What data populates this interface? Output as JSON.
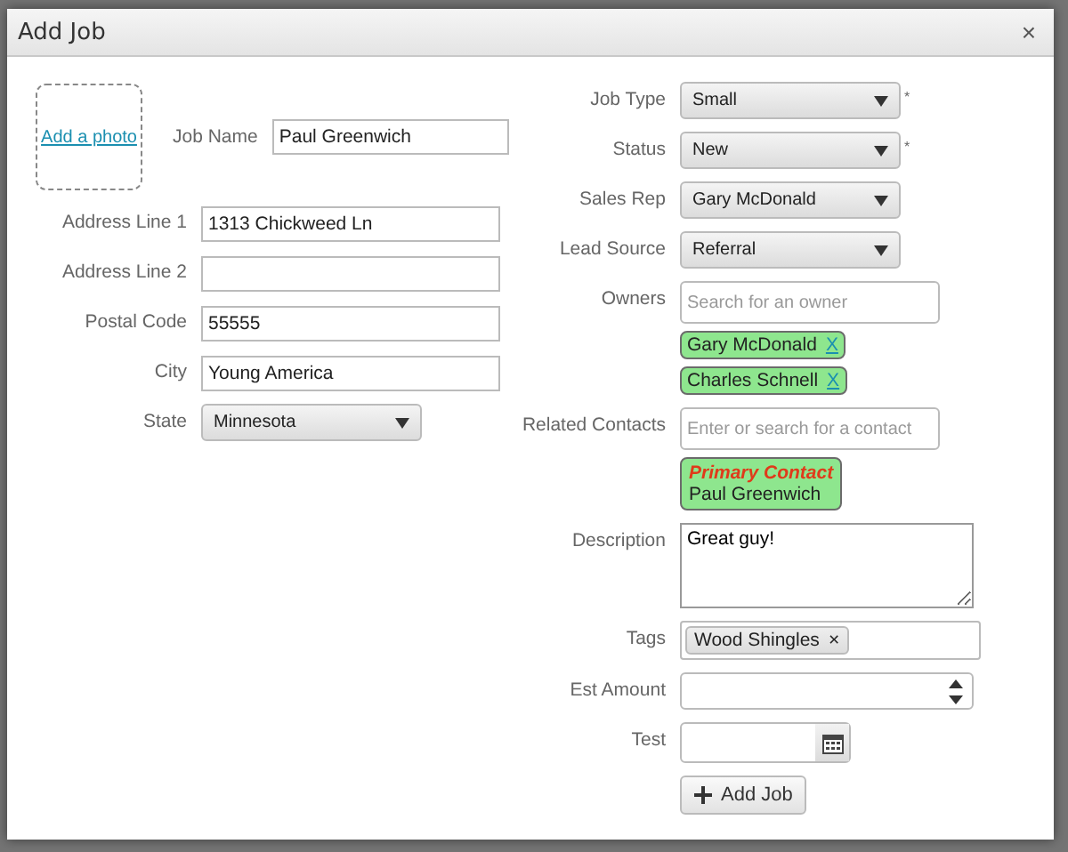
{
  "dialog": {
    "title": "Add Job",
    "close": "×"
  },
  "photo": {
    "link": "Add a photo"
  },
  "job_name": {
    "label": "Job Name",
    "value": "Paul Greenwich"
  },
  "left_fields": [
    {
      "kind": "text",
      "label": "Address Line 1",
      "value": "1313 Chickweed Ln"
    },
    {
      "kind": "text",
      "label": "Address Line 2"
    },
    {
      "kind": "text",
      "label": "Postal Code",
      "value": "55555"
    },
    {
      "kind": "text",
      "label": "City",
      "value": "Young America"
    },
    {
      "kind": "select",
      "label": "State",
      "value": "Minnesota"
    }
  ],
  "right_fields": [
    {
      "kind": "select",
      "label": "Job Type",
      "value": "Small",
      "required_mark": "*"
    },
    {
      "kind": "select",
      "label": "Status",
      "value": "New",
      "required_mark": "*"
    },
    {
      "kind": "select",
      "label": "Sales Rep",
      "value": "Gary McDonald"
    },
    {
      "kind": "select",
      "label": "Lead Source",
      "value": "Referral"
    },
    {
      "kind": "owners",
      "label": "Owners",
      "placeholder": "Search for an owner",
      "chips": [
        {
          "name": "Gary McDonald",
          "remove": "X"
        },
        {
          "name": "Charles Schnell",
          "remove": "X"
        }
      ]
    },
    {
      "kind": "contacts",
      "label": "Related Contacts",
      "placeholder": "Enter or search for a contact",
      "contacts": [
        {
          "role": "Primary Contact",
          "name": "Paul Greenwich"
        }
      ]
    },
    {
      "kind": "textarea",
      "label": "Description",
      "value": "Great guy!"
    },
    {
      "kind": "tags",
      "label": "Tags",
      "tags": [
        {
          "name": "Wood Shingles",
          "remove": "×"
        }
      ]
    },
    {
      "kind": "number",
      "label": "Est Amount"
    },
    {
      "kind": "date",
      "label": "Test"
    }
  ],
  "submit": {
    "label": "Add Job"
  }
}
